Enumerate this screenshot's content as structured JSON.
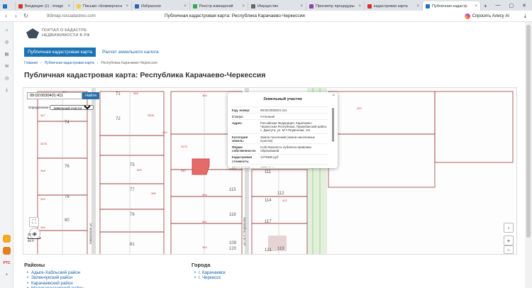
{
  "browser": {
    "tabs": [
      {
        "label": "",
        "color": "#1e73be"
      },
      {
        "label": "Входящие (1) - image",
        "color": "#d93025"
      },
      {
        "label": "Письмо «Коммерческ",
        "color": "#f7c948"
      },
      {
        "label": "Избранное",
        "color": "#2a63b7"
      },
      {
        "label": "Реестр извещений",
        "color": "#34a853"
      },
      {
        "label": "Имущество",
        "color": "#666666"
      },
      {
        "label": "Просмотр процедуры",
        "color": "#8e44ad"
      },
      {
        "label": "кадастровая карта",
        "color": "#d93025"
      },
      {
        "label": "Публичная кадастр",
        "color": "#1e73be"
      }
    ],
    "url": "9l3map.roscadastres.com",
    "page_title": "Публичная кадастровая карта: Республика Карачаево-Черкессия",
    "alice_label": "Спросить Алису AI"
  },
  "side_panel": {
    "badge_label": "PTC"
  },
  "header": {
    "logo_line1": "ПОРТАЛ О КАДАСТРЕ",
    "logo_line2": "НЕДВИЖИМОСТИ В РФ",
    "nav": [
      "Публичная кадастровая карта",
      "Расчет земельного налога"
    ],
    "breadcrumb": [
      "Главная",
      "Публичная кадастровая карта",
      "Республика Карачаево-Черкессия"
    ],
    "title": "Публичная кадастровая карта: Республика Карачаево-Черкессия"
  },
  "map": {
    "search_value": "09:02:0030401:411",
    "search_button": "Найти",
    "ident_label": "Определение",
    "ident_option": "земельный участок",
    "popup": {
      "title": "Земельный участок",
      "rows": [
        {
          "k": "Кад. номер:",
          "v": "09:02:0030401:411"
        },
        {
          "k": "Статус:",
          "v": "Учтенный"
        },
        {
          "k": "Адрес:",
          "v": "Российская Федерация, Карачаево-Черкесская Республика, Прикубанский район, с. Джегута, ул. М.Т.Первенова, 111"
        },
        {
          "k": "Категория земель:",
          "v": "Земли поселений (земли населенных пунктов)"
        },
        {
          "k": "Форма собственности:",
          "v": "Собственность публично-правовых образований"
        },
        {
          "k": "Кадастровая стоимость:",
          "v": "1279480 руб"
        },
        {
          "k": "Уточненная площадь:",
          "v": "1000 кв.м"
        }
      ]
    },
    "street_label": "ул. М.Т. Первенова",
    "street_label2": "Кавказская ул.",
    "scale_top": "20 m",
    "scale_bottom": "60 ft",
    "lot_numbers": [
      "70",
      "71",
      "72",
      "74",
      "75",
      "76",
      "77",
      "78",
      "79",
      "80",
      "81",
      "109",
      "110",
      "111",
      "112",
      "113",
      "114",
      "115",
      "116",
      "117",
      "118",
      "119",
      "120",
      "121"
    ],
    "parcel_codes": [
      "369",
      "347",
      "2678",
      "348",
      "349",
      "350",
      "2605",
      "2679",
      "363",
      "340",
      "371",
      "366",
      "365",
      "364",
      "361",
      "354",
      "410",
      "411",
      "412",
      "415",
      "420"
    ]
  },
  "regions": {
    "title": "Районы",
    "items": [
      "Адыге-Хабльский район",
      "Зеленчукский район",
      "Карачаевский район",
      "Малокарачаевский район"
    ]
  },
  "cities": {
    "title": "Города",
    "items": [
      "г. Карачаевск",
      "г. Черкесск"
    ]
  }
}
